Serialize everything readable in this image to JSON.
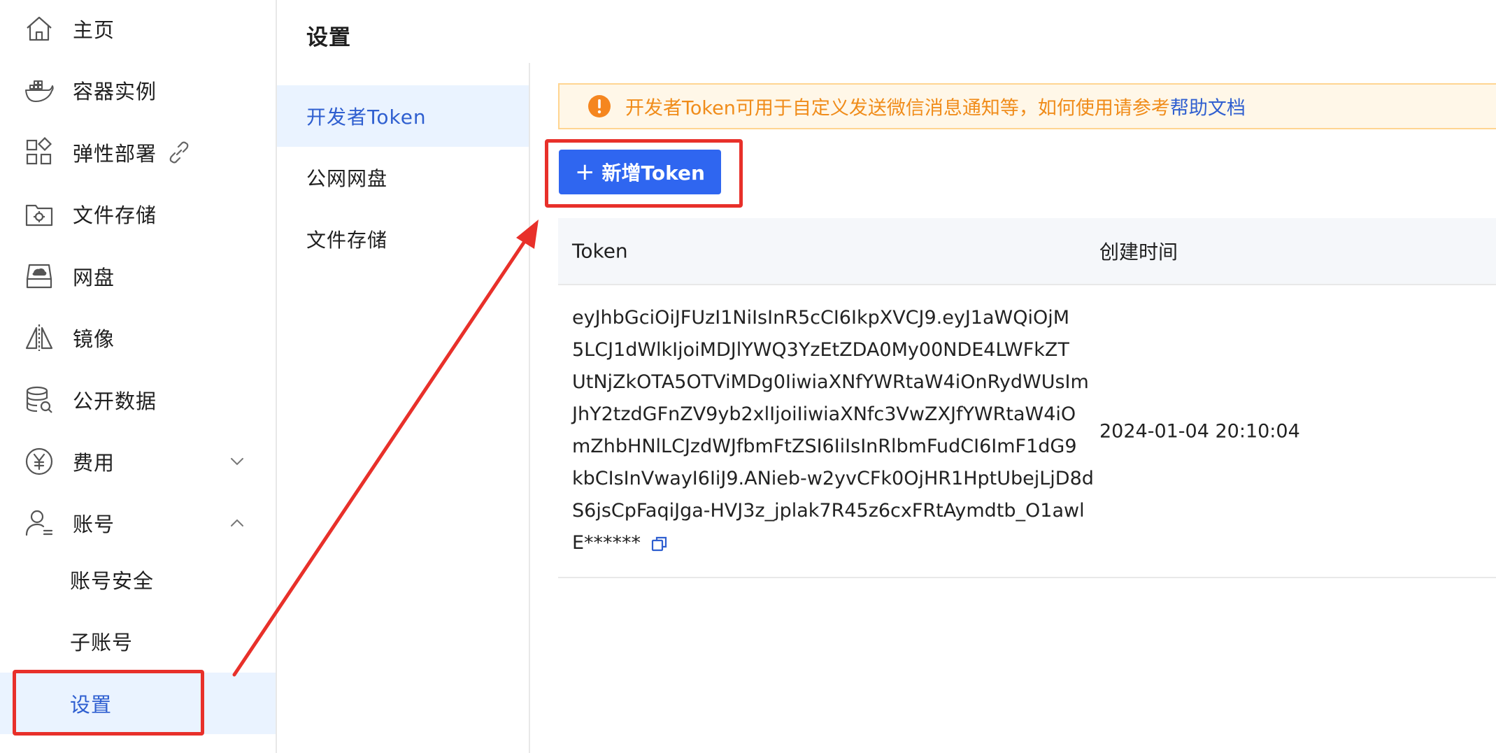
{
  "sidebar": {
    "items": [
      {
        "label": "主页",
        "icon": "home-icon"
      },
      {
        "label": "容器实例",
        "icon": "docker-icon"
      },
      {
        "label": "弹性部署",
        "icon": "grid-icon",
        "extra_icon": "link-icon"
      },
      {
        "label": "文件存储",
        "icon": "folder-gear-icon"
      },
      {
        "label": "网盘",
        "icon": "disk-icon"
      },
      {
        "label": "镜像",
        "icon": "mirror-icon"
      },
      {
        "label": "公开数据",
        "icon": "database-icon"
      },
      {
        "label": "费用",
        "icon": "yuan-icon",
        "chevron": "chevron-down-icon"
      },
      {
        "label": "账号",
        "icon": "user-icon",
        "chevron": "chevron-up-icon"
      }
    ],
    "sub_items": [
      {
        "label": "账号安全"
      },
      {
        "label": "子账号"
      },
      {
        "label": "设置",
        "active": true
      }
    ]
  },
  "page": {
    "title": "设置"
  },
  "settings_menu": {
    "items": [
      {
        "label": "开发者Token",
        "active": true
      },
      {
        "label": "公网网盘"
      },
      {
        "label": "文件存储"
      }
    ]
  },
  "notice": {
    "icon": "exclamation-circle-icon",
    "text": "开发者Token可用于自定义发送微信消息通知等，如何使用请参考",
    "link": "帮助文档"
  },
  "add_button": {
    "label": "新增Token",
    "icon": "plus-icon"
  },
  "table": {
    "columns": [
      "Token",
      "创建时间"
    ],
    "rows": [
      {
        "token_lines": [
          "eyJhbGciOiJFUzI1NiIsInR5cCI6IkpXVCJ9.eyJ1aWQiOjM",
          "5LCJ1dWlkIjoiMDJlYWQ3YzEtZDA0My00NDE4LWFkZT",
          "UtNjZkOTA5OTViMDg0IiwiaXNfYWRtaW4iOnRydWUsIm",
          "JhY2tzdGFnZV9yb2xlIjoiIiwiaXNfc3VwZXJfYWRtaW4iO",
          "mZhbHNlLCJzdWJfbmFtZSI6IiIsInRlbmFudCI6ImF1dG9",
          "kbCIsInVwayI6IiJ9.ANieb-w2yvCFk0OjHR1HptUbejLjD8d",
          "S6jsCpFaqiJga-HVJ3z_jplak7R45z6cxFRtAymdtb_O1awl",
          "E******"
        ],
        "created_at": "2024-01-04 20:10:04",
        "copy_icon": "copy-icon"
      }
    ]
  },
  "colors": {
    "accent": "#2f66f0",
    "active_text": "#2f5fd0",
    "active_bg": "#eaf3ff",
    "warning_text": "#f08c1a",
    "warning_bg": "#fff7e8",
    "annotation_red": "#e8302a"
  }
}
